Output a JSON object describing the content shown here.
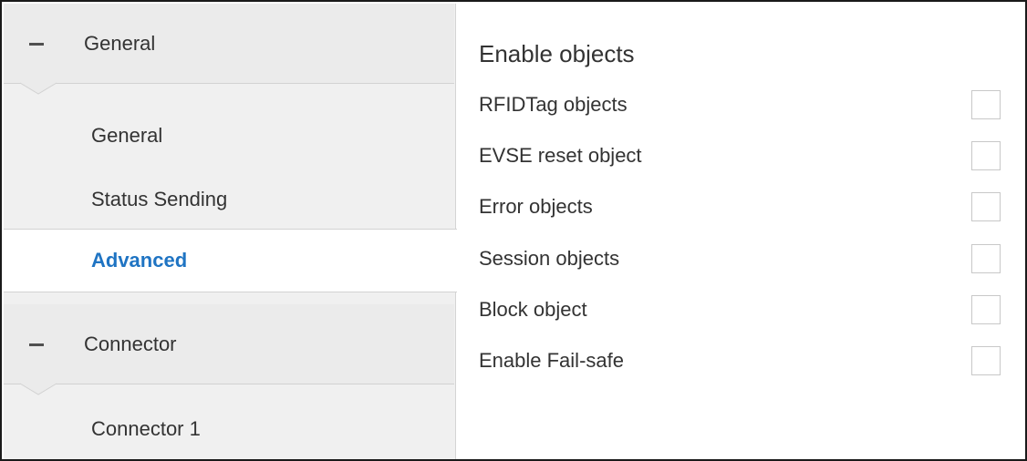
{
  "sidebar": {
    "groups": [
      {
        "title": "General",
        "items": [
          {
            "label": "General"
          },
          {
            "label": "Status Sending"
          },
          {
            "label": "Advanced"
          }
        ]
      },
      {
        "title": "Connector",
        "items": [
          {
            "label": "Connector 1"
          }
        ]
      }
    ],
    "active_item": "Advanced"
  },
  "panel": {
    "title": "Enable objects",
    "options": [
      {
        "label": "RFIDTag objects",
        "checked": false
      },
      {
        "label": "EVSE reset object",
        "checked": false
      },
      {
        "label": "Error objects",
        "checked": false
      },
      {
        "label": "Session objects",
        "checked": false
      },
      {
        "label": "Block object",
        "checked": false
      },
      {
        "label": "Enable Fail-safe",
        "checked": false
      }
    ]
  },
  "colors": {
    "active_text": "#1f74c3",
    "sidebar_bg": "#f0f0f0",
    "header_bg": "#ebebeb",
    "checkbox_border": "#c8c8c8"
  },
  "icons": {
    "group_toggle": "collapse-minus-icon"
  }
}
